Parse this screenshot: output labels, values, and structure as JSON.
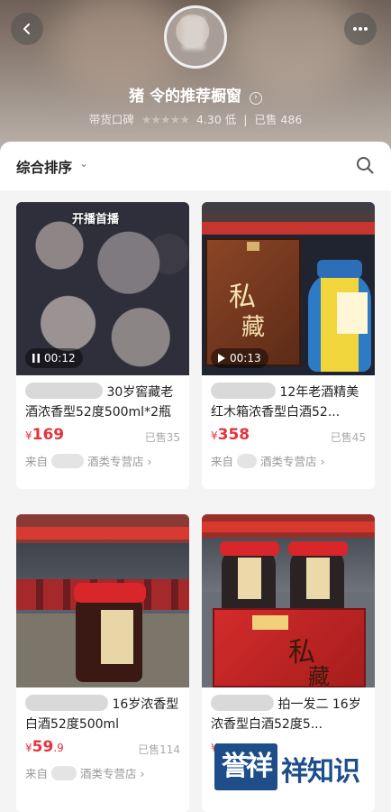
{
  "header": {
    "shop_name": "猪  令的推荐橱窗",
    "shop_arrow": "›",
    "rating_label": "带货口碑",
    "rating_value": "4.30",
    "rating_level": "低",
    "sold_label": "已售",
    "sold_count": "486"
  },
  "sort": {
    "label": "综合排序",
    "chevron": "⌄"
  },
  "products": [
    {
      "title": "30岁窖藏老酒浓香型52度500ml*2瓶",
      "price_symbol": "¥",
      "price_int": "169",
      "price_dec": "",
      "sold": "已售35",
      "store_prefix": "来自",
      "store_suffix": "酒类专营店",
      "store_arrow": "›",
      "duration": "00:12",
      "badge": "开播首播"
    },
    {
      "title": "12年老酒精美红木箱浓香型白酒52...",
      "price_symbol": "¥",
      "price_int": "358",
      "price_dec": "",
      "sold": "已售45",
      "store_prefix": "来自",
      "store_suffix": "酒类专营店",
      "store_arrow": "›",
      "duration": "00:13"
    },
    {
      "title": "16岁浓香型白酒52度500ml",
      "price_symbol": "¥",
      "price_int": "59",
      "price_dec": ".9",
      "sold": "已售114",
      "store_prefix": "来自",
      "store_suffix": "酒类专营店",
      "store_arrow": "›"
    },
    {
      "title": "拍一发二 16岁浓香型白酒52度5...",
      "price_symbol": "¥",
      "price_int": "",
      "price_dec": "",
      "sold": "",
      "store_prefix": "",
      "store_suffix": "",
      "store_arrow": ""
    }
  ],
  "watermark": {
    "box_text": "誉祥",
    "text": "祥知识"
  },
  "colors": {
    "price": "#e5333c",
    "watermark": "#1d4e8a"
  },
  "icons": [
    "back-icon",
    "more-icon",
    "search-icon",
    "chevron-down-icon",
    "pause-icon",
    "play-icon",
    "arrow-right-icon"
  ]
}
